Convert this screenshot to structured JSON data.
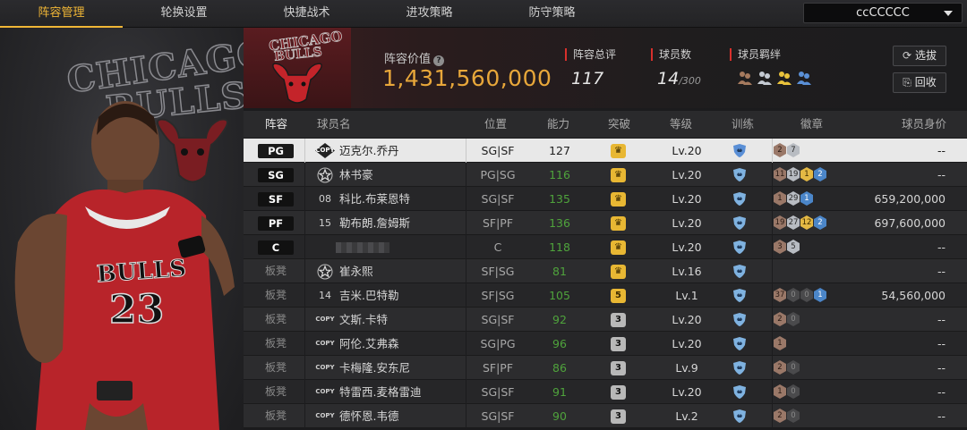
{
  "nav": {
    "tabs": [
      {
        "label": "阵容管理",
        "active": true
      },
      {
        "label": "轮换设置",
        "active": false
      },
      {
        "label": "快捷战术",
        "active": false
      },
      {
        "label": "进攻策略",
        "active": false
      },
      {
        "label": "防守策略",
        "active": false
      }
    ],
    "team_select": "ccCCCCC"
  },
  "hero": {
    "logo_text_line1": "CHICAGO",
    "logo_text_line2": "BULLS",
    "jersey_team": "BULLS",
    "jersey_number": "23"
  },
  "info": {
    "team_logo_text1": "CHICAGO",
    "team_logo_text2": "BULLS",
    "lineup_value_label": "阵容价值",
    "lineup_value": "1,431,560,000",
    "overall_label": "阵容总评",
    "overall_value": "117",
    "players_label": "球员数",
    "players_value": "14",
    "players_max": "/300",
    "bonds_label": "球员羁绊",
    "select_button": "选拔",
    "recycle_button": "回收",
    "colors": {
      "value": "#e8a73a",
      "accent": "#d8302c",
      "tab_active": "#f0b636"
    }
  },
  "table": {
    "headers": [
      "阵容",
      "球员名",
      "位置",
      "能力",
      "突破",
      "等级",
      "训练",
      "徽章",
      "球员身价"
    ],
    "rows": [
      {
        "slot": "PG",
        "starter": true,
        "icon": "copy",
        "name": "迈克尔.乔丹",
        "pos": "SG|SF",
        "ability": "127",
        "ability_color": "white",
        "break": "crown",
        "break_color": "gold",
        "level": "Lv.20",
        "badges": [
          {
            "v": "2",
            "c": "bronze"
          },
          {
            "v": "7",
            "c": "silver"
          }
        ],
        "price": "--",
        "selected": true
      },
      {
        "slot": "SG",
        "starter": true,
        "icon": "star",
        "name": "林书豪",
        "pos": "PG|SG",
        "ability": "116",
        "ability_color": "green",
        "break": "crown",
        "break_color": "gold",
        "level": "Lv.20",
        "badges": [
          {
            "v": "11",
            "c": "bronze"
          },
          {
            "v": "19",
            "c": "silver"
          },
          {
            "v": "1",
            "c": "gold"
          },
          {
            "v": "2",
            "c": "blue"
          }
        ],
        "price": "--"
      },
      {
        "slot": "SF",
        "starter": true,
        "icon": "num",
        "icon_text": "08",
        "name": "科比.布莱恩特",
        "pos": "SG|SF",
        "ability": "135",
        "ability_color": "green",
        "break": "crown",
        "break_color": "gold",
        "level": "Lv.20",
        "badges": [
          {
            "v": "1",
            "c": "bronze"
          },
          {
            "v": "29",
            "c": "silver"
          },
          {
            "v": "1",
            "c": "blue"
          }
        ],
        "price": "659,200,000"
      },
      {
        "slot": "PF",
        "starter": true,
        "icon": "num",
        "icon_text": "15",
        "name": "勒布朗.詹姆斯",
        "pos": "SF|PF",
        "ability": "136",
        "ability_color": "green",
        "break": "crown",
        "break_color": "gold",
        "level": "Lv.20",
        "badges": [
          {
            "v": "19",
            "c": "bronze"
          },
          {
            "v": "27",
            "c": "silver"
          },
          {
            "v": "12",
            "c": "gold"
          },
          {
            "v": "2",
            "c": "blue"
          }
        ],
        "price": "697,600,000"
      },
      {
        "slot": "C",
        "starter": true,
        "icon": "blank",
        "name": "",
        "pos": "C",
        "ability": "118",
        "ability_color": "green",
        "break": "crown",
        "break_color": "gold",
        "level": "Lv.20",
        "badges": [
          {
            "v": "3",
            "c": "bronze"
          },
          {
            "v": "5",
            "c": "silver"
          }
        ],
        "price": "--"
      },
      {
        "slot": "板凳",
        "starter": false,
        "icon": "star",
        "name": "崔永熙",
        "pos": "SF|SG",
        "ability": "81",
        "ability_color": "green",
        "break": "crown",
        "break_color": "gold",
        "level": "Lv.16",
        "badges": [],
        "price": "--"
      },
      {
        "slot": "板凳",
        "starter": false,
        "icon": "num",
        "icon_text": "14",
        "name": "吉米.巴特勒",
        "pos": "SF|SG",
        "ability": "105",
        "ability_color": "green",
        "break": "5",
        "break_color": "gold",
        "level": "Lv.1",
        "badges": [
          {
            "v": "37",
            "c": "bronze"
          },
          {
            "v": "0",
            "c": "dark"
          },
          {
            "v": "0",
            "c": "dark"
          },
          {
            "v": "1",
            "c": "blue"
          }
        ],
        "price": "54,560,000"
      },
      {
        "slot": "板凳",
        "starter": false,
        "icon": "copy",
        "name": "文斯.卡特",
        "pos": "SG|SF",
        "ability": "92",
        "ability_color": "green",
        "break": "3",
        "break_color": "gray",
        "level": "Lv.20",
        "badges": [
          {
            "v": "2",
            "c": "bronze"
          },
          {
            "v": "0",
            "c": "dark"
          }
        ],
        "price": "--"
      },
      {
        "slot": "板凳",
        "starter": false,
        "icon": "copy",
        "name": "阿伦.艾弗森",
        "pos": "SG|PG",
        "ability": "96",
        "ability_color": "green",
        "break": "3",
        "break_color": "gray",
        "level": "Lv.20",
        "badges": [
          {
            "v": "1",
            "c": "bronze"
          }
        ],
        "price": "--"
      },
      {
        "slot": "板凳",
        "starter": false,
        "icon": "copy",
        "name": "卡梅隆.安东尼",
        "pos": "SF|PF",
        "ability": "86",
        "ability_color": "green",
        "break": "3",
        "break_color": "gray",
        "level": "Lv.9",
        "badges": [
          {
            "v": "2",
            "c": "bronze"
          },
          {
            "v": "0",
            "c": "dark"
          }
        ],
        "price": "--"
      },
      {
        "slot": "板凳",
        "starter": false,
        "icon": "copy",
        "name": "特雷西.麦格雷迪",
        "pos": "SG|SF",
        "ability": "91",
        "ability_color": "green",
        "break": "3",
        "break_color": "gray",
        "level": "Lv.20",
        "badges": [
          {
            "v": "1",
            "c": "bronze"
          },
          {
            "v": "0",
            "c": "dark"
          }
        ],
        "price": "--"
      },
      {
        "slot": "板凳",
        "starter": false,
        "icon": "copy",
        "name": "德怀恩.韦德",
        "pos": "SG|SF",
        "ability": "90",
        "ability_color": "green",
        "break": "3",
        "break_color": "gray",
        "level": "Lv.2",
        "badges": [
          {
            "v": "2",
            "c": "bronze"
          },
          {
            "v": "0",
            "c": "dark"
          }
        ],
        "price": "--"
      }
    ]
  }
}
